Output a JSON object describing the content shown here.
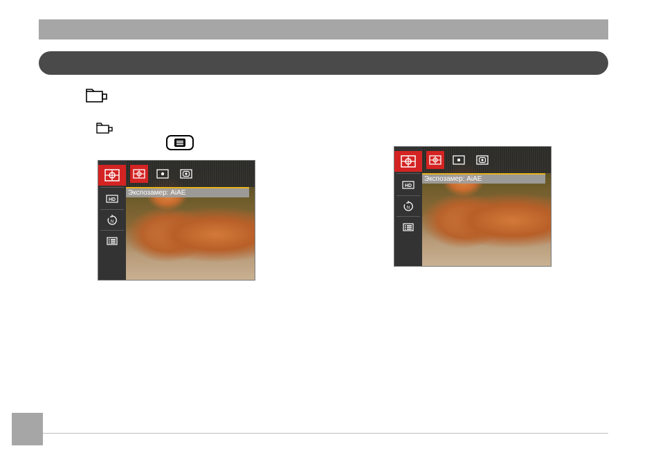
{
  "header": {
    "title": "",
    "section_title": ""
  },
  "icons": {
    "movie_mode_large": "video-camera-icon",
    "movie_mode_small": "video-camera-icon",
    "menu_button": "menu-button-icon"
  },
  "camera_screens": [
    {
      "sidebar": [
        {
          "icon": "exposure-metering-icon",
          "active": true
        },
        {
          "icon": "hd-video-quality-icon",
          "active": false
        },
        {
          "icon": "continuous-af-icon",
          "active": false
        },
        {
          "icon": "menu-list-icon",
          "active": false
        }
      ],
      "options": [
        {
          "icon": "ai-ae-metering-icon",
          "active": true
        },
        {
          "icon": "spot-metering-icon",
          "active": false
        },
        {
          "icon": "center-weighted-metering-icon",
          "active": false
        }
      ],
      "label": "Экспозамер: AiAE"
    },
    {
      "sidebar": [
        {
          "icon": "exposure-metering-icon",
          "active": true
        },
        {
          "icon": "hd-video-quality-icon",
          "active": false
        },
        {
          "icon": "continuous-af-icon",
          "active": false
        },
        {
          "icon": "menu-list-icon",
          "active": false
        }
      ],
      "options": [
        {
          "icon": "ai-ae-metering-icon",
          "active": true
        },
        {
          "icon": "spot-metering-icon",
          "active": false
        },
        {
          "icon": "center-weighted-metering-icon",
          "active": false
        }
      ],
      "label": "Экспозамер: AiAE"
    }
  ],
  "colors": {
    "active_red": "#d32423",
    "highlight_yellow": "#e8b21a",
    "bar_gray": "#a6a6a6",
    "pill_dark": "#4a4a4a"
  }
}
